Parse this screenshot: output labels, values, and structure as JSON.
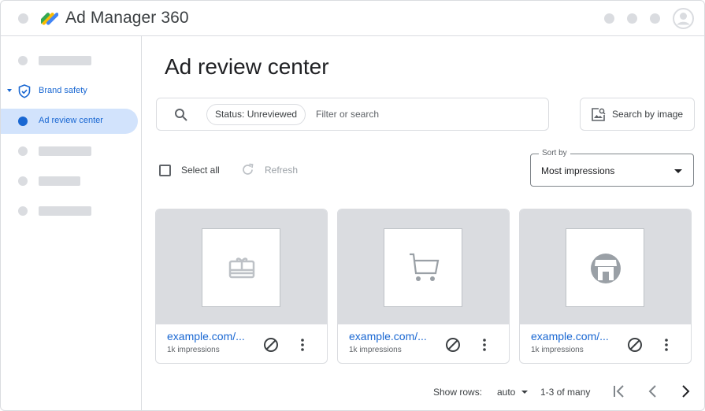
{
  "app": {
    "title": "Ad Manager 360"
  },
  "sidebar": {
    "brand_safety_label": "Brand safety",
    "ad_review_label": "Ad review center"
  },
  "main": {
    "page_title": "Ad review center",
    "search": {
      "chip_label": "Status: Unreviewed",
      "placeholder": "Filter or search"
    },
    "search_by_image_label": "Search by image",
    "select_all_label": "Select all",
    "refresh_label": "Refresh",
    "sort": {
      "legend": "Sort by",
      "value": "Most impressions"
    },
    "cards": [
      {
        "url": "example.com/...",
        "impressions": "1k impressions",
        "icon": "gift-card-icon"
      },
      {
        "url": "example.com/...",
        "impressions": "1k impressions",
        "icon": "shopping-cart-icon"
      },
      {
        "url": "example.com/...",
        "impressions": "1k impressions",
        "icon": "storefront-icon"
      }
    ],
    "pagination": {
      "show_rows_label": "Show rows:",
      "rows_value": "auto",
      "range_label": "1-3 of many"
    }
  },
  "colors": {
    "accent": "#1967d2",
    "active_nav_bg": "#d2e3fc",
    "placeholder_gray": "#dadce0"
  }
}
